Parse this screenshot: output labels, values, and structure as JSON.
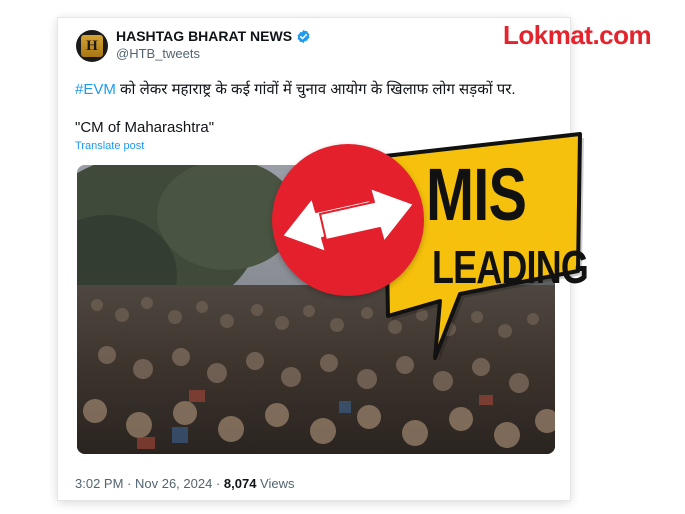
{
  "tweet": {
    "account_name": "HASHTAG BHARAT NEWS",
    "handle": "@HTB_tweets",
    "avatar_letter": "H",
    "hashtag": "#EVM",
    "text_body": " को लेकर महाराष्ट्र के कई गांवों में चुनाव आयोग के खिलाफ लोग सड़कों पर.",
    "quote_line": "\"CM of Maharashtra\"",
    "translate_label": "Translate post",
    "time": "3:02 PM",
    "separator_1": " · ",
    "date": "Nov 26, 2024",
    "separator_2": " · ",
    "views_count": "8,074",
    "views_label": " Views"
  },
  "brand": {
    "logo_text": "Lokmat.com",
    "color": "#e5232c"
  },
  "badge": {
    "line_1": "MIS",
    "line_2": "LEADING",
    "fill_color": "#f5c10c",
    "icon": "swap-arrows-icon"
  },
  "colors": {
    "link": "#1d9bf0",
    "verified": "#1d9bf0",
    "circle": "#e3202c"
  }
}
